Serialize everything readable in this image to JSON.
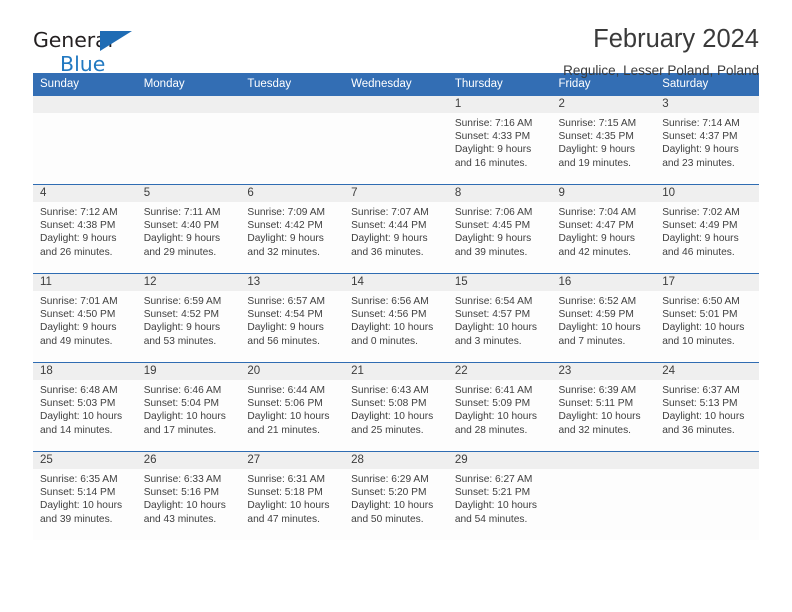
{
  "brand": {
    "name_top": "General",
    "name_bottom": "Blue",
    "triangle_icon": "triangle-icon",
    "accent_color": "#2279c1",
    "dark_color": "#231f20"
  },
  "header": {
    "title": "February 2024",
    "subtitle": "Regulice, Lesser Poland, Poland"
  },
  "theme": {
    "header_row_bg": "#336eb4",
    "row_divider": "#2f6cb2",
    "daynum_strip_bg": "#efefef",
    "cell_bg": "#fdfdfd"
  },
  "weekdays": [
    "Sunday",
    "Monday",
    "Tuesday",
    "Wednesday",
    "Thursday",
    "Friday",
    "Saturday"
  ],
  "labels": {
    "sunrise_prefix": "Sunrise:",
    "sunset_prefix": "Sunset:",
    "daylight_prefix": "Daylight:"
  },
  "weeks": [
    [
      {
        "empty": true
      },
      {
        "empty": true
      },
      {
        "empty": true
      },
      {
        "empty": true
      },
      {
        "day": "1",
        "sunrise": "Sunrise: 7:16 AM",
        "sunset": "Sunset: 4:33 PM",
        "daylight_1": "Daylight: 9 hours",
        "daylight_2": "and 16 minutes."
      },
      {
        "day": "2",
        "sunrise": "Sunrise: 7:15 AM",
        "sunset": "Sunset: 4:35 PM",
        "daylight_1": "Daylight: 9 hours",
        "daylight_2": "and 19 minutes."
      },
      {
        "day": "3",
        "sunrise": "Sunrise: 7:14 AM",
        "sunset": "Sunset: 4:37 PM",
        "daylight_1": "Daylight: 9 hours",
        "daylight_2": "and 23 minutes."
      }
    ],
    [
      {
        "day": "4",
        "sunrise": "Sunrise: 7:12 AM",
        "sunset": "Sunset: 4:38 PM",
        "daylight_1": "Daylight: 9 hours",
        "daylight_2": "and 26 minutes."
      },
      {
        "day": "5",
        "sunrise": "Sunrise: 7:11 AM",
        "sunset": "Sunset: 4:40 PM",
        "daylight_1": "Daylight: 9 hours",
        "daylight_2": "and 29 minutes."
      },
      {
        "day": "6",
        "sunrise": "Sunrise: 7:09 AM",
        "sunset": "Sunset: 4:42 PM",
        "daylight_1": "Daylight: 9 hours",
        "daylight_2": "and 32 minutes."
      },
      {
        "day": "7",
        "sunrise": "Sunrise: 7:07 AM",
        "sunset": "Sunset: 4:44 PM",
        "daylight_1": "Daylight: 9 hours",
        "daylight_2": "and 36 minutes."
      },
      {
        "day": "8",
        "sunrise": "Sunrise: 7:06 AM",
        "sunset": "Sunset: 4:45 PM",
        "daylight_1": "Daylight: 9 hours",
        "daylight_2": "and 39 minutes."
      },
      {
        "day": "9",
        "sunrise": "Sunrise: 7:04 AM",
        "sunset": "Sunset: 4:47 PM",
        "daylight_1": "Daylight: 9 hours",
        "daylight_2": "and 42 minutes."
      },
      {
        "day": "10",
        "sunrise": "Sunrise: 7:02 AM",
        "sunset": "Sunset: 4:49 PM",
        "daylight_1": "Daylight: 9 hours",
        "daylight_2": "and 46 minutes."
      }
    ],
    [
      {
        "day": "11",
        "sunrise": "Sunrise: 7:01 AM",
        "sunset": "Sunset: 4:50 PM",
        "daylight_1": "Daylight: 9 hours",
        "daylight_2": "and 49 minutes."
      },
      {
        "day": "12",
        "sunrise": "Sunrise: 6:59 AM",
        "sunset": "Sunset: 4:52 PM",
        "daylight_1": "Daylight: 9 hours",
        "daylight_2": "and 53 minutes."
      },
      {
        "day": "13",
        "sunrise": "Sunrise: 6:57 AM",
        "sunset": "Sunset: 4:54 PM",
        "daylight_1": "Daylight: 9 hours",
        "daylight_2": "and 56 minutes."
      },
      {
        "day": "14",
        "sunrise": "Sunrise: 6:56 AM",
        "sunset": "Sunset: 4:56 PM",
        "daylight_1": "Daylight: 10 hours",
        "daylight_2": "and 0 minutes."
      },
      {
        "day": "15",
        "sunrise": "Sunrise: 6:54 AM",
        "sunset": "Sunset: 4:57 PM",
        "daylight_1": "Daylight: 10 hours",
        "daylight_2": "and 3 minutes."
      },
      {
        "day": "16",
        "sunrise": "Sunrise: 6:52 AM",
        "sunset": "Sunset: 4:59 PM",
        "daylight_1": "Daylight: 10 hours",
        "daylight_2": "and 7 minutes."
      },
      {
        "day": "17",
        "sunrise": "Sunrise: 6:50 AM",
        "sunset": "Sunset: 5:01 PM",
        "daylight_1": "Daylight: 10 hours",
        "daylight_2": "and 10 minutes."
      }
    ],
    [
      {
        "day": "18",
        "sunrise": "Sunrise: 6:48 AM",
        "sunset": "Sunset: 5:03 PM",
        "daylight_1": "Daylight: 10 hours",
        "daylight_2": "and 14 minutes."
      },
      {
        "day": "19",
        "sunrise": "Sunrise: 6:46 AM",
        "sunset": "Sunset: 5:04 PM",
        "daylight_1": "Daylight: 10 hours",
        "daylight_2": "and 17 minutes."
      },
      {
        "day": "20",
        "sunrise": "Sunrise: 6:44 AM",
        "sunset": "Sunset: 5:06 PM",
        "daylight_1": "Daylight: 10 hours",
        "daylight_2": "and 21 minutes."
      },
      {
        "day": "21",
        "sunrise": "Sunrise: 6:43 AM",
        "sunset": "Sunset: 5:08 PM",
        "daylight_1": "Daylight: 10 hours",
        "daylight_2": "and 25 minutes."
      },
      {
        "day": "22",
        "sunrise": "Sunrise: 6:41 AM",
        "sunset": "Sunset: 5:09 PM",
        "daylight_1": "Daylight: 10 hours",
        "daylight_2": "and 28 minutes."
      },
      {
        "day": "23",
        "sunrise": "Sunrise: 6:39 AM",
        "sunset": "Sunset: 5:11 PM",
        "daylight_1": "Daylight: 10 hours",
        "daylight_2": "and 32 minutes."
      },
      {
        "day": "24",
        "sunrise": "Sunrise: 6:37 AM",
        "sunset": "Sunset: 5:13 PM",
        "daylight_1": "Daylight: 10 hours",
        "daylight_2": "and 36 minutes."
      }
    ],
    [
      {
        "day": "25",
        "sunrise": "Sunrise: 6:35 AM",
        "sunset": "Sunset: 5:14 PM",
        "daylight_1": "Daylight: 10 hours",
        "daylight_2": "and 39 minutes."
      },
      {
        "day": "26",
        "sunrise": "Sunrise: 6:33 AM",
        "sunset": "Sunset: 5:16 PM",
        "daylight_1": "Daylight: 10 hours",
        "daylight_2": "and 43 minutes."
      },
      {
        "day": "27",
        "sunrise": "Sunrise: 6:31 AM",
        "sunset": "Sunset: 5:18 PM",
        "daylight_1": "Daylight: 10 hours",
        "daylight_2": "and 47 minutes."
      },
      {
        "day": "28",
        "sunrise": "Sunrise: 6:29 AM",
        "sunset": "Sunset: 5:20 PM",
        "daylight_1": "Daylight: 10 hours",
        "daylight_2": "and 50 minutes."
      },
      {
        "day": "29",
        "sunrise": "Sunrise: 6:27 AM",
        "sunset": "Sunset: 5:21 PM",
        "daylight_1": "Daylight: 10 hours",
        "daylight_2": "and 54 minutes."
      },
      {
        "empty": true
      },
      {
        "empty": true
      }
    ]
  ]
}
